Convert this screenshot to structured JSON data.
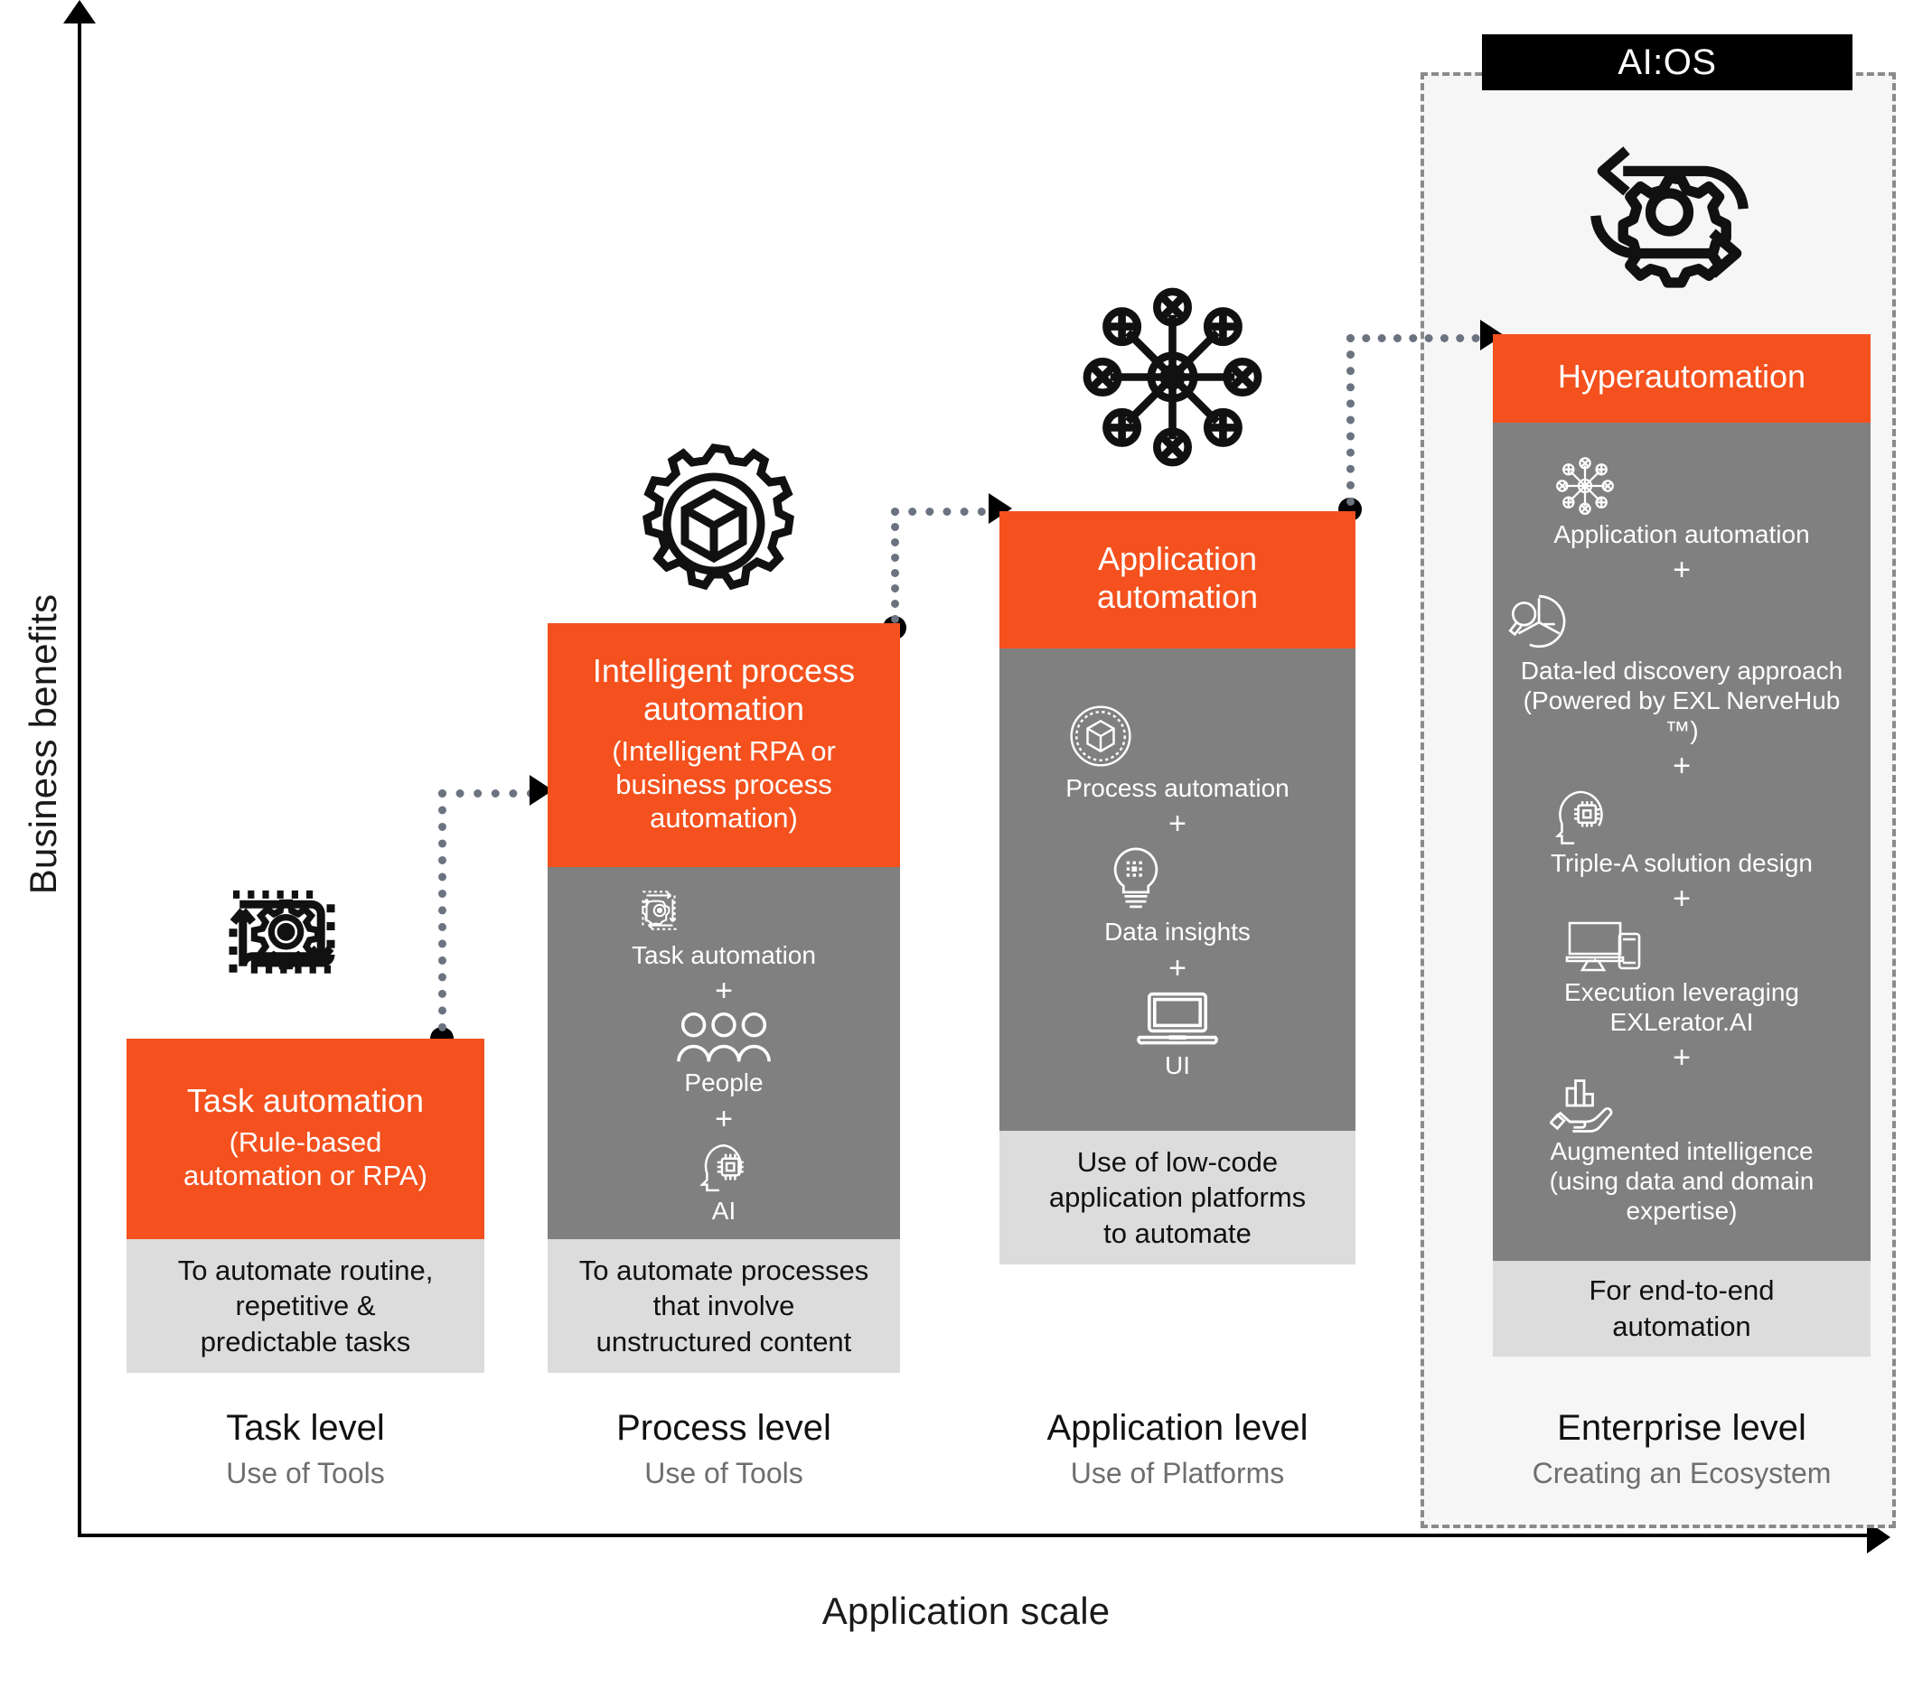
{
  "axes": {
    "y_label": "Business benefits",
    "x_label": "Application scale"
  },
  "enterprise_banner": {
    "label": "AI:OS"
  },
  "columns": [
    {
      "id": "task",
      "header_title": "Task automation",
      "header_sub": "(Rule-based\nautomation or RPA)",
      "footer": "To automate routine,\nrepetitive &\npredictable tasks",
      "items": [],
      "level_title": "Task level",
      "level_sub": "Use of Tools",
      "top_icon": "gear-cycle-icon"
    },
    {
      "id": "process",
      "header_title": "Intelligent process\nautomation",
      "header_sub": "(Intelligent RPA or\nbusiness process\nautomation)",
      "footer": "To automate processes\nthat involve\nunstructured content",
      "items": [
        {
          "icon": "task-automation-icon",
          "label": "Task automation"
        },
        {
          "icon": "people-icon",
          "label": "People"
        },
        {
          "icon": "ai-head-icon",
          "label": "AI"
        }
      ],
      "level_title": "Process level",
      "level_sub": "Use of Tools",
      "top_icon": "gear-cube-icon"
    },
    {
      "id": "application",
      "header_title": "Application\nautomation",
      "header_sub": "",
      "footer": "Use of low-code\napplication platforms\nto automate",
      "items": [
        {
          "icon": "gear-cube-icon",
          "label": "Process automation"
        },
        {
          "icon": "lightbulb-data-icon",
          "label": "Data insights"
        },
        {
          "icon": "laptop-icon",
          "label": "UI"
        }
      ],
      "level_title": "Application level",
      "level_sub": "Use of Platforms",
      "top_icon": "network-hub-icon"
    },
    {
      "id": "hyperautomation",
      "header_title": "Hyperautomation",
      "header_sub": "",
      "footer": "For end-to-end\nautomation",
      "items": [
        {
          "icon": "network-hub-icon",
          "label": "Application automation"
        },
        {
          "icon": "pie-search-icon",
          "label": "Data-led discovery approach\n(Powered by EXL NerveHub ™)"
        },
        {
          "icon": "ai-head-icon",
          "label": "Triple-A solution design"
        },
        {
          "icon": "devices-icon",
          "label": "Execution leveraging\nEXLerator.AI"
        },
        {
          "icon": "hand-chart-icon",
          "label": "Augmented intelligence\n(using data and domain\nexpertise)"
        }
      ],
      "level_title": "Enterprise level",
      "level_sub": "Creating an Ecosystem",
      "top_icon": "gear-refresh-icon"
    }
  ],
  "separator": "+",
  "colors": {
    "accent_orange": "#f4511e",
    "body_gray": "#808080",
    "footer_gray": "#dcdcdc",
    "enterprise_bg": "#f6f6f6",
    "connector_gray": "#6b7280",
    "banner_black": "#000000"
  }
}
